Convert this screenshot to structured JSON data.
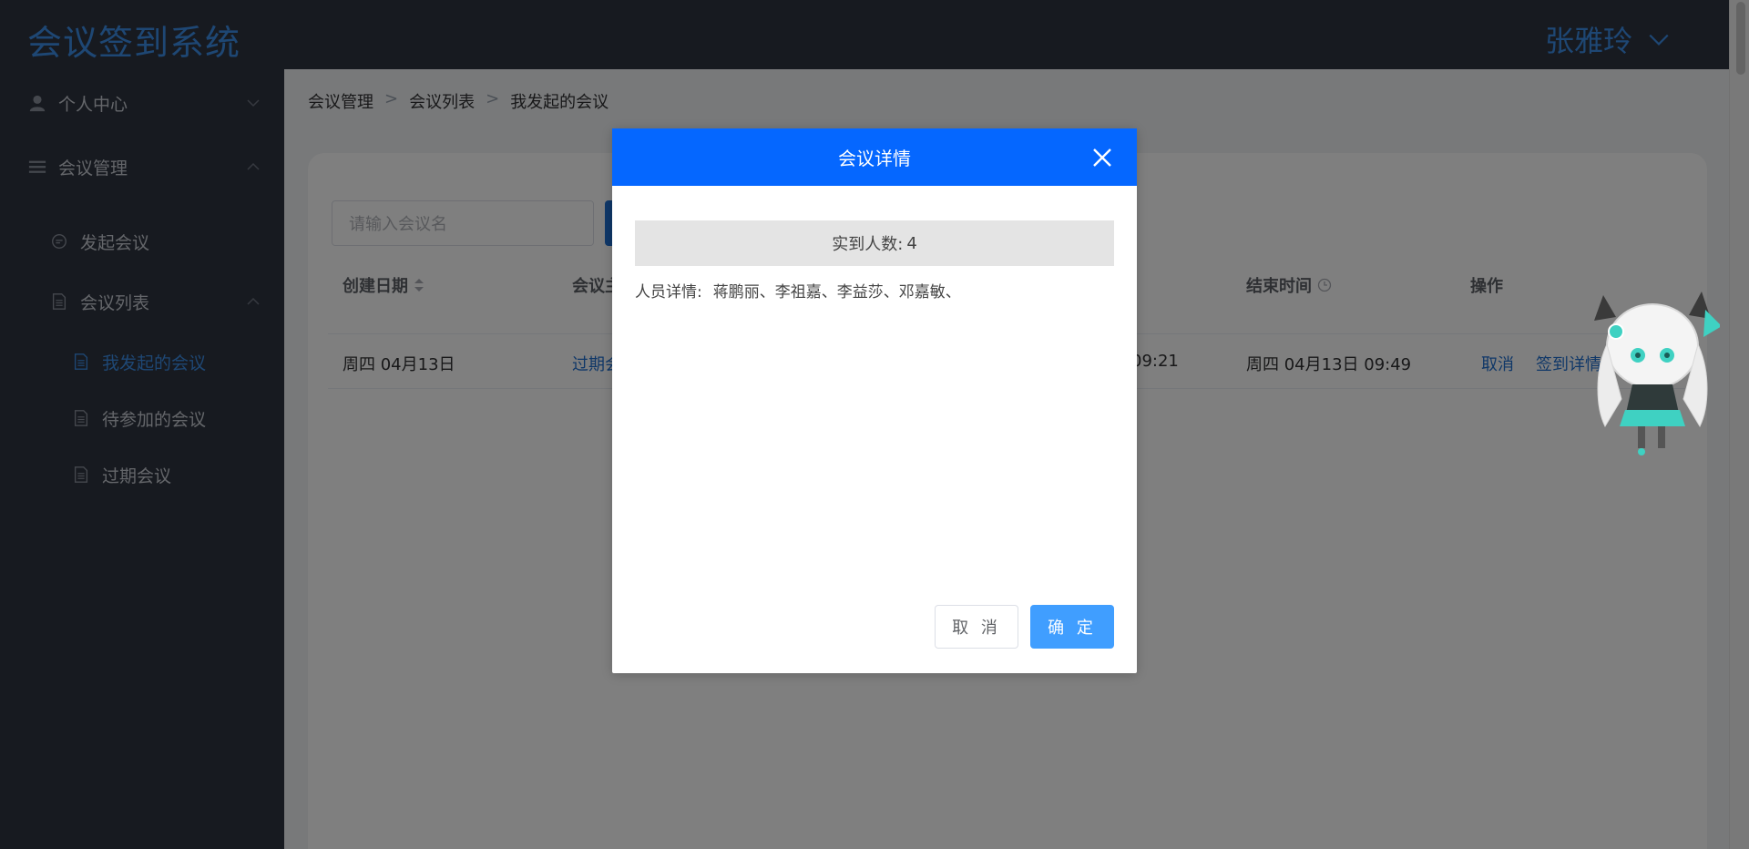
{
  "app": {
    "title": "会议签到系统",
    "user_name": "张雅玲"
  },
  "sidebar": {
    "sections": [
      {
        "label": "个人中心"
      },
      {
        "label": "会议管理"
      }
    ],
    "items": [
      {
        "label": "发起会议"
      },
      {
        "label": "会议列表"
      }
    ],
    "subitems": [
      {
        "label": "我发起的会议",
        "active": true
      },
      {
        "label": "待参加的会议"
      },
      {
        "label": "过期会议"
      }
    ]
  },
  "breadcrumb": [
    "会议管理",
    "会议列表",
    "我发起的会议"
  ],
  "search": {
    "placeholder": "请输入会议名"
  },
  "table": {
    "headers": [
      "创建日期",
      "会议主",
      "结束时间",
      "操作"
    ],
    "row": {
      "created": "周四 04月13日",
      "topic_partial": "过期会",
      "start_partial": "09:21",
      "end": "周四 04月13日 09:49",
      "action_cancel": "取消",
      "action_detail": "签到详情"
    }
  },
  "modal": {
    "title": "会议详情",
    "count_label": "实到人数:",
    "count_value": "4",
    "people_label": "人员详情:",
    "people_list": "蒋鹏丽、李祖嘉、李益莎、邓嘉敏、",
    "cancel_label": "取 消",
    "ok_label": "确 定"
  },
  "colors": {
    "accent": "#3d8fe8",
    "header_bg": "#2f3541",
    "modal_header": "#0567ff",
    "primary_button": "#409eff"
  },
  "icons": {
    "user": "user-icon",
    "menu": "menu-lines-icon",
    "chat": "chat-icon",
    "doc": "document-icon",
    "close": "close-icon",
    "chevron": "chevron-down-icon",
    "sort": "sort-icon",
    "clock": "clock-icon"
  }
}
